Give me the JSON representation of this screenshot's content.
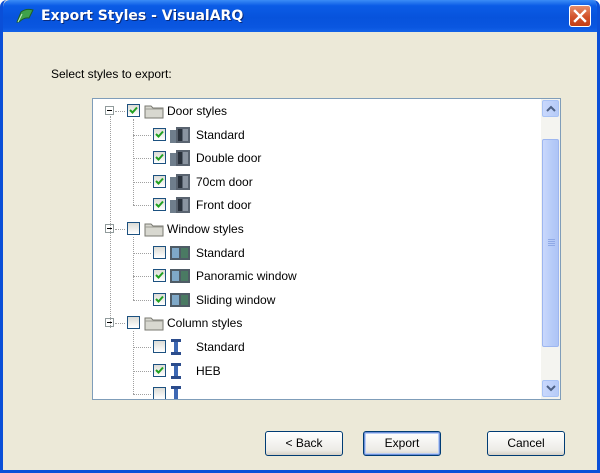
{
  "window": {
    "title": "Export Styles - VisualARQ",
    "accent_color": "#0a56e0",
    "close_color": "#d2522a"
  },
  "prompt": "Select styles to export:",
  "tree": {
    "groups": [
      {
        "label": "Door styles",
        "checked": true,
        "expanded": true,
        "icon": "folder-icon",
        "items": [
          {
            "label": "Standard",
            "checked": true,
            "icon": "door-icon"
          },
          {
            "label": "Double door",
            "checked": true,
            "icon": "door-icon"
          },
          {
            "label": "70cm door",
            "checked": true,
            "icon": "door-icon"
          },
          {
            "label": "Front door",
            "checked": true,
            "icon": "door-icon"
          }
        ]
      },
      {
        "label": "Window styles",
        "checked": false,
        "expanded": true,
        "icon": "folder-icon",
        "items": [
          {
            "label": "Standard",
            "checked": false,
            "icon": "window-icon"
          },
          {
            "label": "Panoramic window",
            "checked": true,
            "icon": "window-icon"
          },
          {
            "label": "Sliding window",
            "checked": true,
            "icon": "window-icon"
          }
        ]
      },
      {
        "label": "Column styles",
        "checked": false,
        "expanded": true,
        "icon": "folder-icon",
        "items": [
          {
            "label": "Standard",
            "checked": false,
            "icon": "column-icon"
          },
          {
            "label": "HEB",
            "checked": true,
            "icon": "column-icon"
          },
          {
            "label": "",
            "checked": false,
            "icon": "column-icon"
          }
        ]
      }
    ]
  },
  "buttons": {
    "back": "< Back",
    "export": "Export",
    "cancel": "Cancel"
  }
}
